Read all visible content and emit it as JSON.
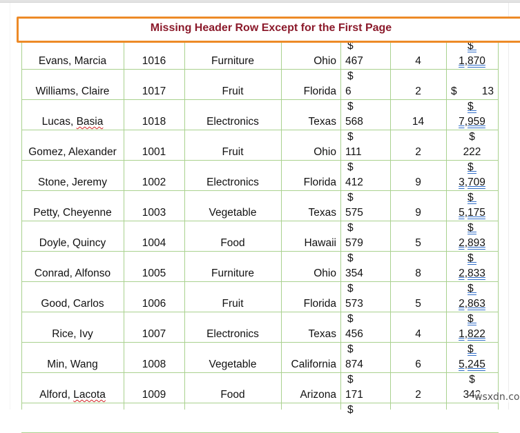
{
  "title": "Missing Header Row Except for the First Page",
  "currency_symbol": "$",
  "rows": [
    {
      "name": "Evans, Marcia",
      "id": "1016",
      "product": "Furniture",
      "state": "Ohio",
      "price": "467",
      "qty": "4",
      "total": "1,870",
      "total_style": "link",
      "name_spell": false
    },
    {
      "name": "Williams, Claire",
      "id": "1017",
      "product": "Fruit",
      "state": "Florida",
      "price": "6",
      "qty": "2",
      "total": "13",
      "total_style": "inline",
      "name_spell": false
    },
    {
      "name": "Lucas, Basia",
      "id": "1018",
      "product": "Electronics",
      "state": "Texas",
      "price": "568",
      "qty": "14",
      "total": "7,959",
      "total_style": "link",
      "name_spell": true
    },
    {
      "name": "Gomez, Alexander",
      "id": "1001",
      "product": "Fruit",
      "state": "Ohio",
      "price": "111",
      "qty": "2",
      "total": "222",
      "total_style": "plain",
      "name_spell": false
    },
    {
      "name": "Stone, Jeremy",
      "id": "1002",
      "product": "Electronics",
      "state": "Florida",
      "price": "412",
      "qty": "9",
      "total": "3,709",
      "total_style": "link",
      "name_spell": false
    },
    {
      "name": "Petty, Cheyenne",
      "id": "1003",
      "product": "Vegetable",
      "state": "Texas",
      "price": "575",
      "qty": "9",
      "total": "5,175",
      "total_style": "link",
      "name_spell": false
    },
    {
      "name": "Doyle, Quincy",
      "id": "1004",
      "product": "Food",
      "state": "Hawaii",
      "price": "579",
      "qty": "5",
      "total": "2,893",
      "total_style": "link",
      "name_spell": false
    },
    {
      "name": "Conrad, Alfonso",
      "id": "1005",
      "product": "Furniture",
      "state": "Ohio",
      "price": "354",
      "qty": "8",
      "total": "2,833",
      "total_style": "link",
      "name_spell": false
    },
    {
      "name": "Good, Carlos",
      "id": "1006",
      "product": "Fruit",
      "state": "Florida",
      "price": "573",
      "qty": "5",
      "total": "2,863",
      "total_style": "link",
      "name_spell": false
    },
    {
      "name": "Rice, Ivy",
      "id": "1007",
      "product": "Electronics",
      "state": "Texas",
      "price": "456",
      "qty": "4",
      "total": "1,822",
      "total_style": "link",
      "name_spell": false
    },
    {
      "name": "Min, Wang",
      "id": "1008",
      "product": "Vegetable",
      "state": "California",
      "price": "874",
      "qty": "6",
      "total": "5,245",
      "total_style": "link",
      "name_spell": false
    },
    {
      "name": "Alford, Lacota",
      "id": "1009",
      "product": "Food",
      "state": "Arizona",
      "price": "171",
      "qty": "2",
      "total": "342",
      "total_style": "plain",
      "name_spell": true
    }
  ],
  "watermark": "wsxdn.com",
  "colors": {
    "title_text": "#8b1a2b",
    "title_border": "#ed8a27",
    "grid_line": "#a9d18e",
    "link_underline": "#2e6bc6"
  }
}
